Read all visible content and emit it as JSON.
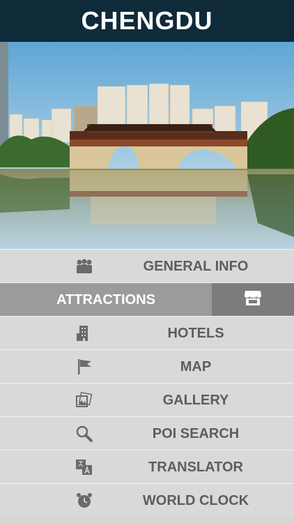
{
  "header": {
    "title": "CHENGDU"
  },
  "menu": {
    "items": [
      {
        "label": "GENERAL INFO",
        "icon": "people-icon"
      },
      {
        "label": "ATTRACTIONS",
        "icon": "store-icon",
        "active": true
      },
      {
        "label": "HOTELS",
        "icon": "building-icon"
      },
      {
        "label": "MAP",
        "icon": "flag-icon"
      },
      {
        "label": "GALLERY",
        "icon": "gallery-icon"
      },
      {
        "label": "POI SEARCH",
        "icon": "magnifier-icon"
      },
      {
        "label": "TRANSLATOR",
        "icon": "translate-icon"
      },
      {
        "label": "WORLD CLOCK",
        "icon": "alarm-clock-icon"
      }
    ]
  },
  "colors": {
    "header_bg": "#0f2a38",
    "menu_bg": "#d9d9d9",
    "active_bg": "#9b9b9b",
    "active_side_bg": "#7c7c7c",
    "menu_text": "#5d5d5d"
  }
}
